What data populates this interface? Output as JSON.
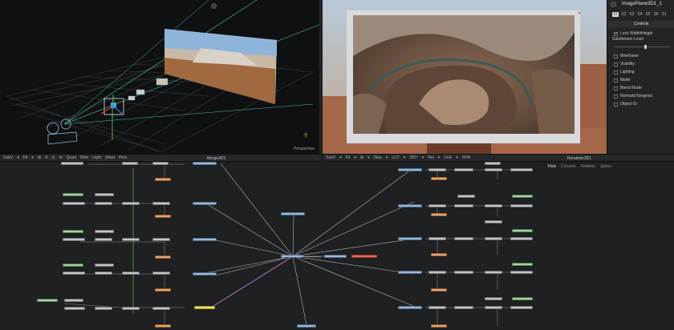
{
  "viewer_left": {
    "label": "Perspective"
  },
  "viewer_right": {},
  "inspector": {
    "node_title": "ImagePlane3D1_1",
    "tabs": [
      "S1",
      "S2",
      "S3",
      "S4",
      "S5",
      "S6",
      "S1"
    ],
    "section": "Controls",
    "lock_label": "Lock Width/Height",
    "subdivision_label": "Subdivision Level",
    "options": [
      "Wireframe",
      "Visibility",
      "Lighting",
      "Matte",
      "Blend Mode",
      "Normals/Tangents",
      "Object ID"
    ]
  },
  "toolbar_left": {
    "items": [
      "SubV",
      "▾",
      "Fit",
      "▾",
      "⊞",
      "A",
      "⊡",
      "⊘",
      "Quad",
      "Wire",
      "Light",
      "Shad",
      "Pers"
    ],
    "title": "Merge3D1"
  },
  "toolbar_right": {
    "items": [
      "SubV",
      "▾",
      "Fit",
      "▾",
      "⊞",
      "▾",
      "Step",
      "▾",
      "LUT",
      "▾",
      "360°",
      "▾",
      "Roi",
      "▾",
      "DoD",
      "▾",
      "SHR"
    ],
    "title": "Renderer3D1"
  },
  "flow": {
    "tabs": [
      "Flow",
      "Console",
      "Timeline",
      "Spline"
    ]
  },
  "colors": {
    "bg": "#1b1c1e",
    "panel": "#232427",
    "flow_bg": "#1f2022",
    "accent": "#e0e2e4"
  }
}
